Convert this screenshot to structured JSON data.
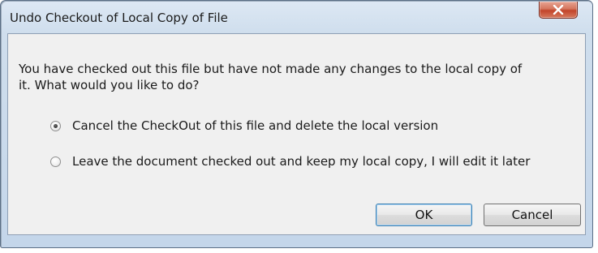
{
  "window": {
    "title": "Undo Checkout of Local Copy of File",
    "close_icon": "close-x-icon"
  },
  "message": {
    "line1": "You have checked out this file but have not made any changes to the local copy of",
    "line2": "it.  What would you like to do?"
  },
  "options": [
    {
      "label": "Cancel the CheckOut of this file and delete the local version",
      "selected": true
    },
    {
      "label": "Leave the document checked out and keep my local copy, I will edit it later",
      "selected": false
    }
  ],
  "buttons": {
    "ok": "OK",
    "cancel": "Cancel"
  },
  "colors": {
    "close_button": "#c7462c",
    "dialog_frame": "#cfdeed",
    "content_bg": "#f0f0f0",
    "default_button_border": "#3c7fb1"
  }
}
